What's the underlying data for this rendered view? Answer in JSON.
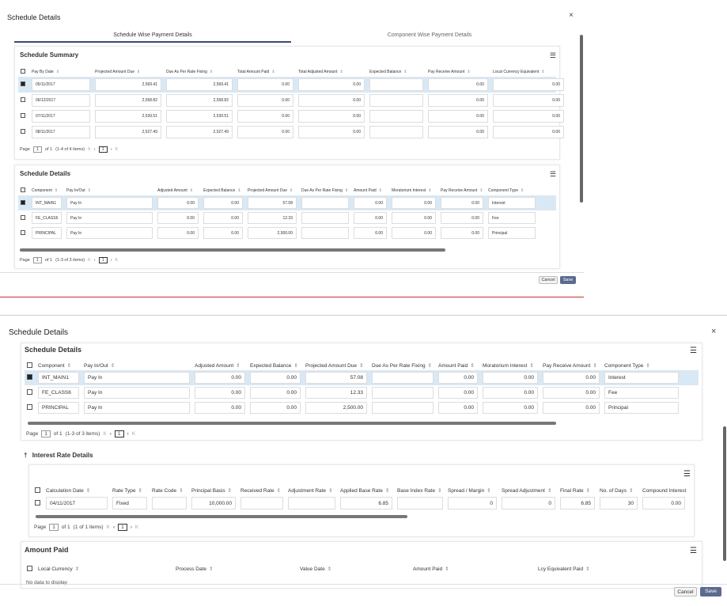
{
  "win1": {
    "title": "Schedule Details",
    "tabs": [
      "Schedule Wise Payment Details",
      "Component Wise Payment Details"
    ],
    "summary": {
      "title": "Schedule Summary",
      "headers": [
        "Pay By Date",
        "Projected Amount Due",
        "Due As Per Rate Fixing",
        "Total Amount Paid",
        "Total Adjusted Amount",
        "Expected Balance",
        "Pay Receive Amount",
        "Local Currency Equivalent"
      ],
      "rows": [
        [
          "05/11/2017",
          "2,569.41",
          "2,569.41",
          "0.00",
          "0.00",
          "",
          "0.00",
          "0.00"
        ],
        [
          "06/12/2017",
          "2,558.82",
          "2,558.82",
          "0.00",
          "0.00",
          "",
          "0.00",
          "0.00"
        ],
        [
          "07/11/2017",
          "2,539.51",
          "2,539.51",
          "0.00",
          "0.00",
          "",
          "0.00",
          "0.00"
        ],
        [
          "08/11/2017",
          "2,527.49",
          "2,527.49",
          "0.00",
          "0.00",
          "",
          "0.00",
          "0.00"
        ]
      ],
      "pager": {
        "page": "Page",
        "num": "1",
        "of": "of 1",
        "items": "(1-4 of 4 items)",
        "first": "K",
        "prev": "‹",
        "cur": "1",
        "next": "›",
        "last": "K"
      }
    },
    "details": {
      "title": "Schedule Details",
      "headers": [
        "Component",
        "Pay In/Out",
        "Adjusted Amount",
        "Expected Balance",
        "Projected Amount Due",
        "Due As Per Rate Fixing",
        "Amount Paid",
        "Moratorium Interest",
        "Pay Receive Amount",
        "Component Type"
      ],
      "rows": [
        [
          "INT_MAIN1",
          "Pay In",
          "0.00",
          "0.00",
          "57.08",
          "",
          "0.00",
          "0.00",
          "0.00",
          "Interest"
        ],
        [
          "FE_CLASS6",
          "Pay In",
          "0.00",
          "0.00",
          "12.33",
          "",
          "0.00",
          "0.00",
          "0.00",
          "Fee"
        ],
        [
          "PRINCIPAL",
          "Pay In",
          "0.00",
          "0.00",
          "2,500.00",
          "",
          "0.00",
          "0.00",
          "0.00",
          "Principal"
        ]
      ],
      "pager": {
        "page": "Page",
        "num": "1",
        "of": "of 1",
        "items": "(1-3 of 3 items)",
        "first": "K",
        "prev": "‹",
        "cur": "1",
        "next": "›",
        "last": "K"
      }
    },
    "cancel": "Cancel",
    "save": "Save"
  },
  "win2": {
    "title": "Schedule Details",
    "details": {
      "title": "Schedule Details",
      "headers": [
        "Component",
        "Pay In/Out",
        "Adjusted Amount",
        "Expected Balance",
        "Projected Amount Due",
        "Due As Per Rate Fixing",
        "Amount Paid",
        "Moratorium Interest",
        "Pay Receive Amount",
        "Component Type"
      ],
      "rows": [
        [
          "INT_MAIN1",
          "Pay In",
          "0.00",
          "0.00",
          "57.08",
          "",
          "0.00",
          "0.00",
          "0.00",
          "Interest"
        ],
        [
          "FE_CLASS6",
          "Pay In",
          "0.00",
          "0.00",
          "12.33",
          "",
          "0.00",
          "0.00",
          "0.00",
          "Fee"
        ],
        [
          "PRINCIPAL",
          "Pay In",
          "0.00",
          "0.00",
          "2,500.00",
          "",
          "0.00",
          "0.00",
          "0.00",
          "Principal"
        ]
      ],
      "pager": {
        "page": "Page",
        "num": "1",
        "of": "of 1",
        "items": "(1-3 of 3 items)",
        "first": "K",
        "prev": "‹",
        "cur": "1",
        "next": "›",
        "last": "K"
      }
    },
    "interest": {
      "title": "Interest Rate Details",
      "headers": [
        "Calculation Date",
        "Rate Type",
        "Rate Code",
        "Principal Basis",
        "Received Rate",
        "Adjustment Rate",
        "Applied Base Rate",
        "Base Index Rate",
        "Spread / Margin",
        "Spread Adjustment",
        "Final Rate",
        "No. of Days",
        "Compound Interest"
      ],
      "rows": [
        [
          "04/11/2017",
          "Fixed",
          "",
          "10,000.00",
          "",
          "",
          "6.85",
          "",
          "0",
          "0",
          "6.85",
          "30",
          "0.00"
        ]
      ],
      "pager": {
        "page": "Page",
        "num": "1",
        "of": "of 1",
        "items": "(1 of 1 items)",
        "first": "K",
        "prev": "‹",
        "cur": "1",
        "next": "›",
        "last": "K"
      }
    },
    "amount_paid": {
      "title": "Amount Paid",
      "headers": [
        "Local Currency",
        "Process Date",
        "Value Date",
        "Amount Paid",
        "Lcy Equivalent Paid"
      ],
      "no_data": "No data to display"
    },
    "cancel": "Cancel",
    "save": "Save"
  }
}
